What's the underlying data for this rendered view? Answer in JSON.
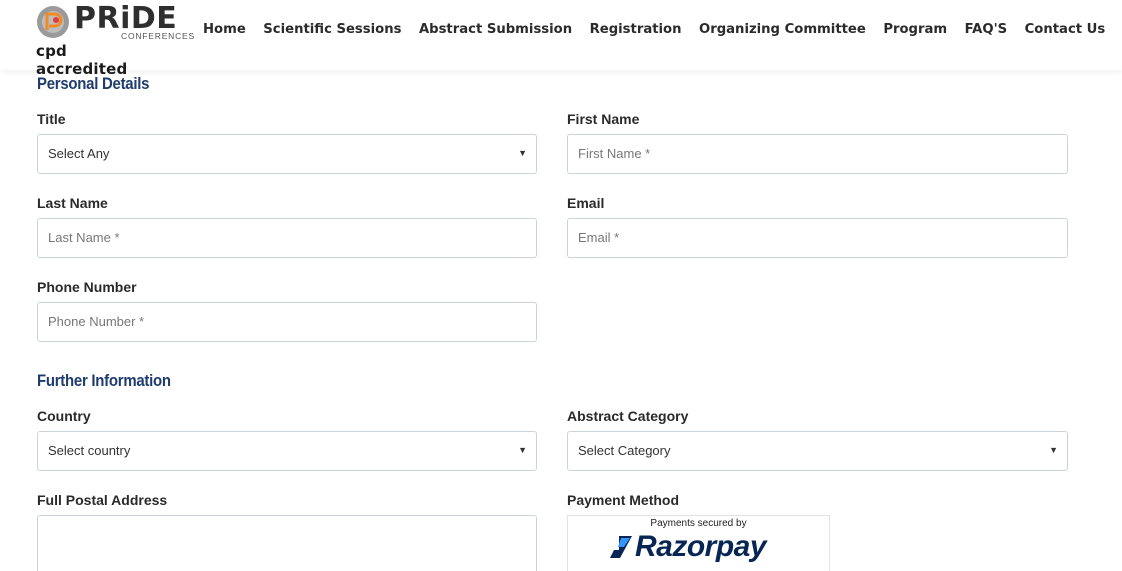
{
  "header": {
    "logo": {
      "brand": "PRiDE",
      "sub": "CONFERENCES",
      "tagline": "cpd accredited"
    },
    "nav": [
      {
        "label": "Home"
      },
      {
        "label": "Scientific Sessions"
      },
      {
        "label": "Abstract Submission"
      },
      {
        "label": "Registration"
      },
      {
        "label": "Organizing Committee"
      },
      {
        "label": "Program"
      },
      {
        "label": "FAQ'S"
      },
      {
        "label": "Contact Us"
      }
    ],
    "plus_icon": "plus-circle-icon",
    "accent_color": "#f08a24"
  },
  "personal": {
    "title": "Personal Details",
    "title_field": {
      "label": "Title",
      "value": "Select Any"
    },
    "first_name": {
      "label": "First Name",
      "placeholder": "First Name *"
    },
    "last_name": {
      "label": "Last Name",
      "placeholder": "Last Name *"
    },
    "email": {
      "label": "Email",
      "placeholder": "Email *"
    },
    "phone": {
      "label": "Phone Number",
      "placeholder": "Phone Number *"
    }
  },
  "further": {
    "title": "Further Information",
    "country": {
      "label": "Country",
      "value": "Select country"
    },
    "abstract_category": {
      "label": "Abstract Category",
      "value": "Select Category"
    },
    "postal_address": {
      "label": "Full Postal Address"
    },
    "payment_method": {
      "label": "Payment Method",
      "secured_text": "Payments secured by",
      "provider": "Razorpay"
    }
  },
  "colors": {
    "section_title": "#1f3c6e",
    "razorpay_blue": "#072654",
    "razorpay_light": "#3395ff"
  }
}
